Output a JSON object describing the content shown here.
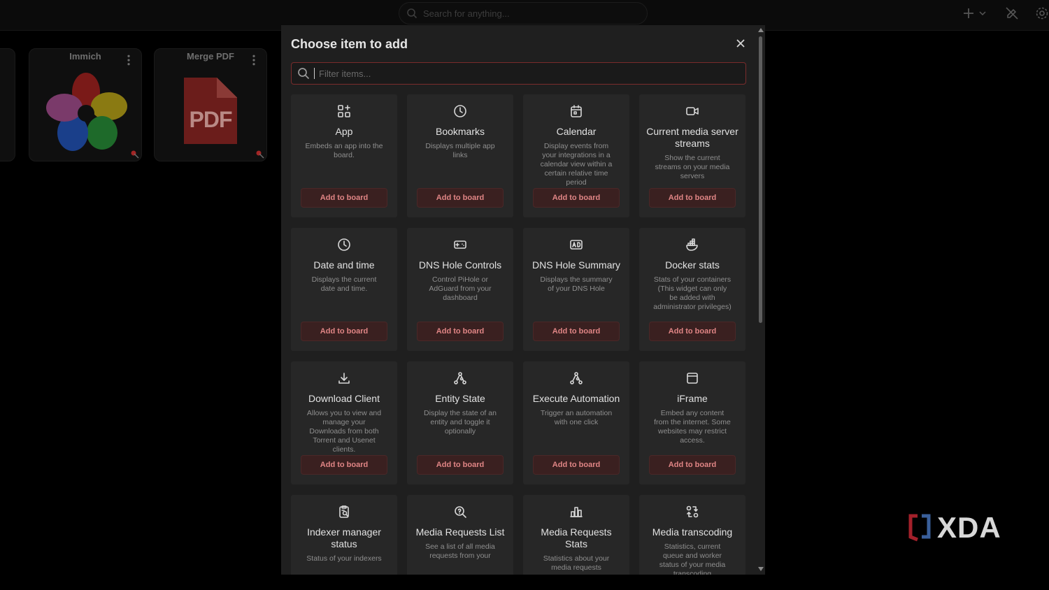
{
  "topbar": {
    "search_placeholder": "Search for anything..."
  },
  "board": {
    "tiles": [
      {
        "title": "Immich"
      },
      {
        "title": "Merge PDF",
        "image_text": "PDF"
      }
    ]
  },
  "modal": {
    "title": "Choose item to add",
    "filter_placeholder": "Filter items...",
    "add_label": "Add to board",
    "items": [
      {
        "icon": "app-icon",
        "name": "App",
        "desc": "Embeds an app into the board."
      },
      {
        "icon": "clock-icon",
        "name": "Bookmarks",
        "desc": "Displays multiple app links"
      },
      {
        "icon": "calendar-icon",
        "name": "Calendar",
        "desc": "Display events from your integrations in a calendar view within a certain relative time period"
      },
      {
        "icon": "video-icon",
        "name": "Current media server streams",
        "desc": "Show the current streams on your media servers"
      },
      {
        "icon": "clock-icon",
        "name": "Date and time",
        "desc": "Displays the current date and time."
      },
      {
        "icon": "gamepad-icon",
        "name": "DNS Hole Controls",
        "desc": "Control PiHole or AdGuard from your dashboard"
      },
      {
        "icon": "ad-icon",
        "name": "DNS Hole Summary",
        "desc": "Displays the summary of your DNS Hole"
      },
      {
        "icon": "docker-icon",
        "name": "Docker stats",
        "desc": "Stats of your containers (This widget can only be added with administrator privileges)"
      },
      {
        "icon": "download-icon",
        "name": "Download Client",
        "desc": "Allows you to view and manage your Downloads from both Torrent and Usenet clients."
      },
      {
        "icon": "network-icon",
        "name": "Entity State",
        "desc": "Display the state of an entity and toggle it optionally"
      },
      {
        "icon": "network-icon",
        "name": "Execute Automation",
        "desc": "Trigger an automation with one click"
      },
      {
        "icon": "browser-icon",
        "name": "iFrame",
        "desc": "Embed any content from the internet. Some websites may restrict access."
      },
      {
        "icon": "clipboard-search-icon",
        "name": "Indexer manager status",
        "desc": "Status of your indexers"
      },
      {
        "icon": "search-question-icon",
        "name": "Media Requests List",
        "desc": "See a list of all media requests from your"
      },
      {
        "icon": "bar-chart-icon",
        "name": "Media Requests Stats",
        "desc": "Statistics about your media requests"
      },
      {
        "icon": "transcode-icon",
        "name": "Media transcoding",
        "desc": "Statistics, current queue and worker status of your media transcoding"
      }
    ]
  },
  "watermark": {
    "text": "XDA"
  },
  "colors": {
    "accent": "#e08585",
    "accent_border": "#7a2c2c",
    "modal_bg": "#1f1f1f",
    "card_bg": "#272727"
  }
}
